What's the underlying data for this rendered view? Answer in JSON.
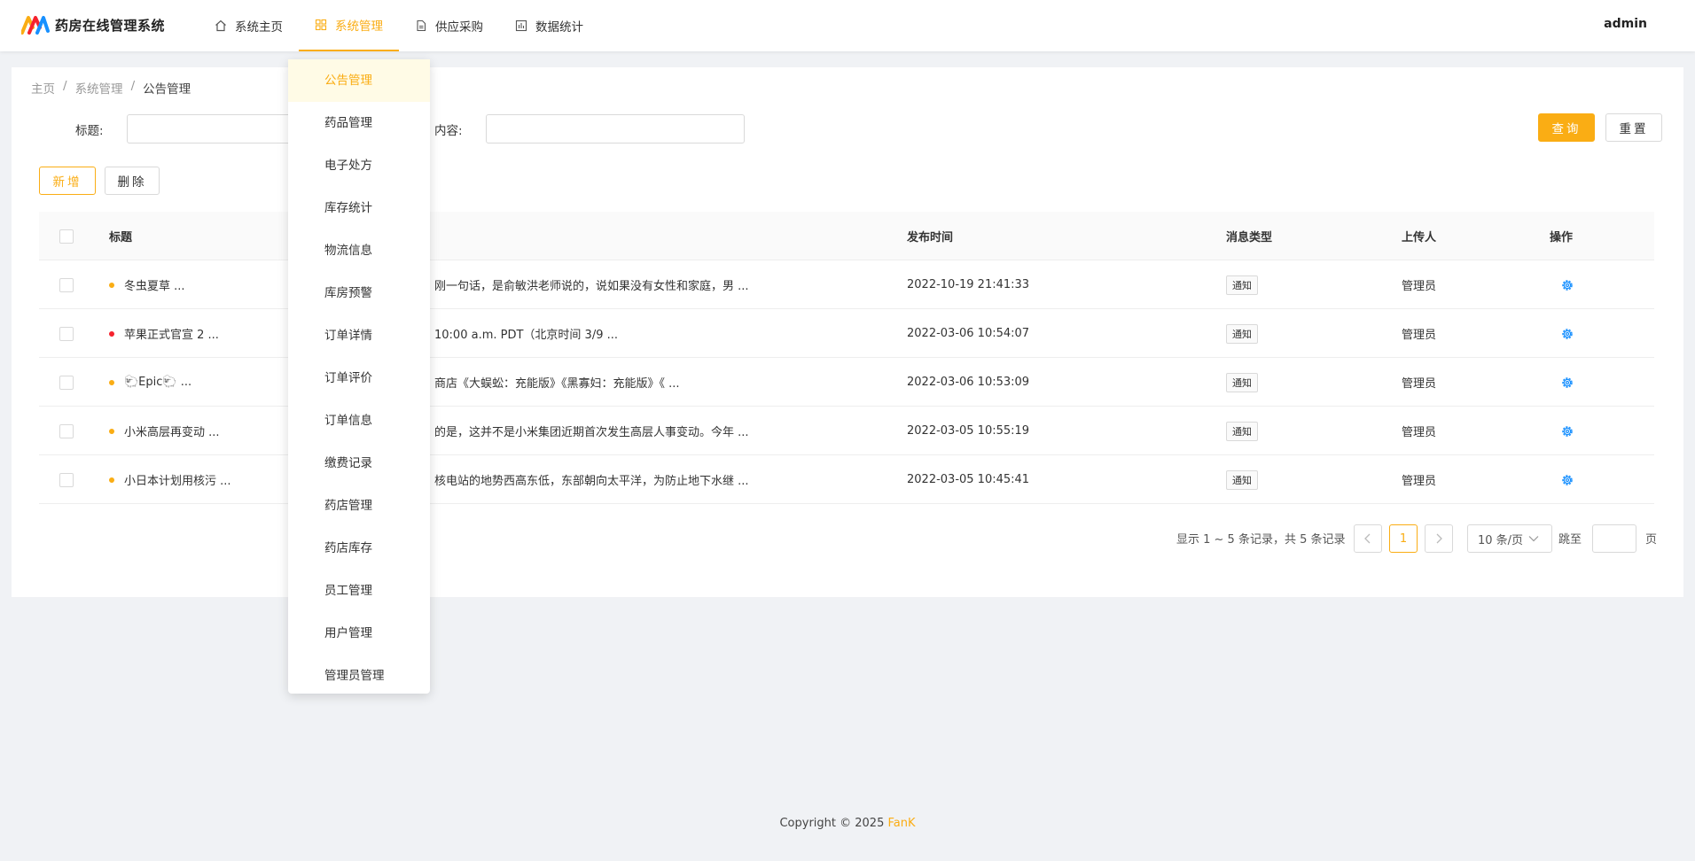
{
  "app": {
    "title": "药房在线管理系统",
    "user": "admin"
  },
  "nav": [
    {
      "label": "系统主页",
      "icon": "home-icon"
    },
    {
      "label": "系统管理",
      "icon": "grid-icon",
      "active": true
    },
    {
      "label": "供应采购",
      "icon": "document-icon"
    },
    {
      "label": "数据统计",
      "icon": "chart-icon"
    }
  ],
  "breadcrumb": [
    "主页",
    "系统管理",
    "公告管理"
  ],
  "search": {
    "title_label": "标题:",
    "content_label": "内容:",
    "title_value": "",
    "content_value": "",
    "query_button": "查询",
    "reset_button": "重置"
  },
  "toolbar": {
    "add_button": "新增",
    "delete_button": "删除"
  },
  "table": {
    "headers": {
      "title": "标题",
      "publish_time": "发布时间",
      "message_type": "消息类型",
      "uploader": "上传人",
      "actions": "操作"
    },
    "rows": [
      {
        "title": "冬虫夏草 ...",
        "dot_color": "#faad14",
        "content": "刚一句话，是俞敏洪老师说的，说如果没有女性和家庭，男 ...",
        "time": "2022-10-19 21:41:33",
        "type": "通知",
        "uploader": "管理员"
      },
      {
        "title": "苹果正式官宣 2 ...",
        "dot_color": "#f5222d",
        "content": "10:00 a.m. PDT（北京时间 3/9 ...",
        "time": "2022-03-06 10:54:07",
        "type": "通知",
        "uploader": "管理员"
      },
      {
        "title": "🐑Epic🐑 ...",
        "dot_color": "#faad14",
        "content": "商店《大蜈蚣：充能版》《黑寡妇：充能版》《 ...",
        "time": "2022-03-06 10:53:09",
        "type": "通知",
        "uploader": "管理员"
      },
      {
        "title": "小米高层再变动 ...",
        "dot_color": "#faad14",
        "content": "的是，这并不是小米集团近期首次发生高层人事变动。今年 ...",
        "time": "2022-03-05 10:55:19",
        "type": "通知",
        "uploader": "管理员"
      },
      {
        "title": "小日本计划用核污 ...",
        "dot_color": "#faad14",
        "content": "核电站的地势西高东低，东部朝向太平洋，为防止地下水继 ...",
        "time": "2022-03-05 10:45:41",
        "type": "通知",
        "uploader": "管理员"
      }
    ]
  },
  "pagination": {
    "summary": "显示 1 ~ 5 条记录，共 5 条记录",
    "current_page": "1",
    "page_size": "10 条/页",
    "jump_label": "跳至",
    "page_suffix": "页",
    "prev": "<",
    "next": ">"
  },
  "dropdown": [
    "公告管理",
    "药品管理",
    "电子处方",
    "库存统计",
    "物流信息",
    "库房预警",
    "订单详情",
    "订单评价",
    "订单信息",
    "缴费记录",
    "药店管理",
    "药店库存",
    "员工管理",
    "用户管理",
    "管理员管理"
  ],
  "footer": {
    "copyright": "Copyright © 2025",
    "brand": "FanK"
  },
  "colors": {
    "accent": "#faad14",
    "link": "#1890ff"
  }
}
